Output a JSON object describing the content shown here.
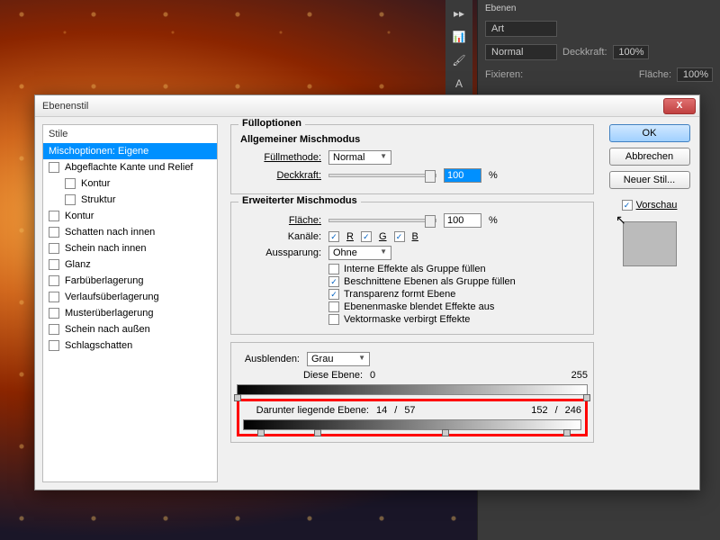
{
  "ps": {
    "panel": "Ebenen",
    "kind": "Art",
    "mode": "Normal",
    "deckLabel": "Deckkraft:",
    "deckVal": "100%",
    "fixLabel": "Fixieren:",
    "flacheLabel": "Fläche:",
    "flacheVal": "100%"
  },
  "dlg": {
    "title": "Ebenenstil",
    "close": "X"
  },
  "left": {
    "hdr": "Stile",
    "sel": "Mischoptionen: Eigene",
    "items": [
      "Abgeflachte Kante und Relief",
      "Kontur",
      "Struktur",
      "Kontur",
      "Schatten nach innen",
      "Schein nach innen",
      "Glanz",
      "Farbüberlagerung",
      "Verlaufsüberlagerung",
      "Musterüberlagerung",
      "Schein nach außen",
      "Schlagschatten"
    ],
    "indent": [
      1,
      2
    ]
  },
  "opts": {
    "legend": "Fülloptionen",
    "sec1": "Allgemeiner Mischmodus",
    "fillLabel": "Füllmethode:",
    "fillVal": "Normal",
    "opLabel": "Deckkraft:",
    "opVal": "100",
    "pct": "%",
    "sec2": "Erweiterter Mischmodus",
    "areaLabel": "Fläche:",
    "areaVal": "100",
    "chanLabel": "Kanäle:",
    "r": "R",
    "g": "G",
    "b": "B",
    "knockLabel": "Aussparung:",
    "knockVal": "Ohne",
    "cb1": "Interne Effekte als Gruppe füllen",
    "cb1v": false,
    "cb2": "Beschnittene Ebenen als Gruppe füllen",
    "cb2v": true,
    "cb3": "Transparenz formt Ebene",
    "cb3v": true,
    "cb4": "Ebenenmaske blendet Effekte aus",
    "cb4v": false,
    "cb5": "Vektormaske verbirgt Effekte",
    "cb5v": false,
    "blendLabel": "Ausblenden:",
    "blendVal": "Grau",
    "thisLabel": "Diese Ebene:",
    "thisLo": "0",
    "thisHi": "255",
    "underLabel": "Darunter liegende Ebene:",
    "u1": "14",
    "us1": "/",
    "u2": "57",
    "u3": "152",
    "us2": "/",
    "u4": "246"
  },
  "right": {
    "ok": "OK",
    "cancel": "Abbrechen",
    "newstyle": "Neuer Stil...",
    "preview": "Vorschau"
  }
}
